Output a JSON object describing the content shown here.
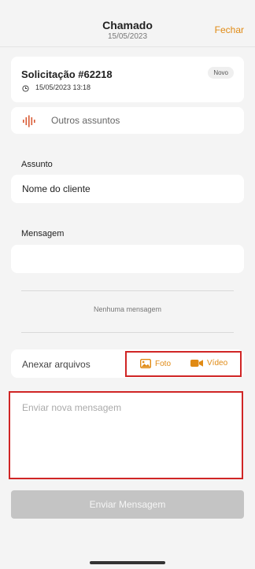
{
  "header": {
    "title": "Chamado",
    "date": "15/05/2023",
    "close_label": "Fechar"
  },
  "request": {
    "title": "Solicitação #62218",
    "datetime": "15/05/2023 13:18",
    "status": "Novo"
  },
  "topic": {
    "label": "Outros assuntos"
  },
  "subject": {
    "label": "Assunto",
    "value": "Nome do cliente"
  },
  "message": {
    "label": "Mensagem",
    "value": ""
  },
  "conversation": {
    "empty_text": "Nenhuma mensagem"
  },
  "attach": {
    "label": "Anexar arquivos",
    "photo_label": "Foto",
    "video_label": "Vídeo"
  },
  "compose": {
    "placeholder": "Enviar nova mensagem"
  },
  "send": {
    "label": "Enviar Mensagem"
  },
  "colors": {
    "accent": "#e08a14",
    "highlight": "#d02525",
    "disabled": "#c4c4c4"
  }
}
